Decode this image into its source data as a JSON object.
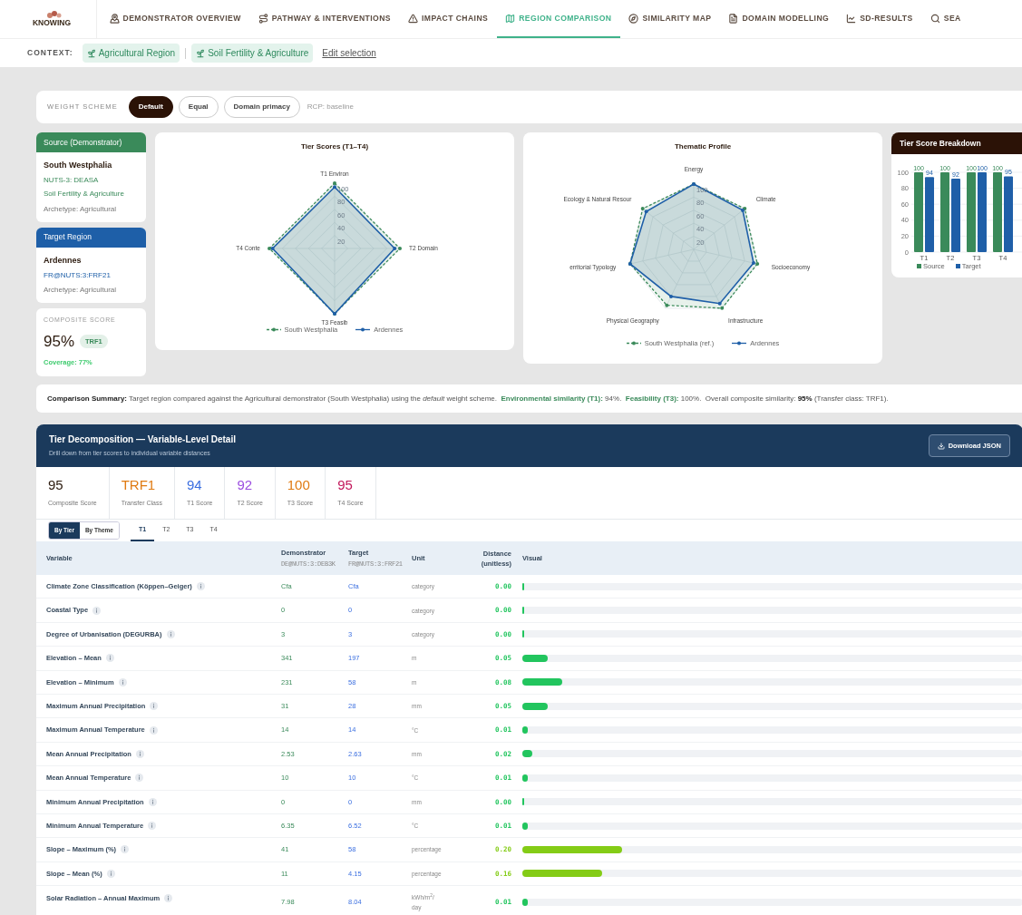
{
  "logo": "KNOWING",
  "nav": [
    {
      "label": "DEMONSTRATOR OVERVIEW",
      "selected": false
    },
    {
      "label": "PATHWAY & INTERVENTIONS",
      "selected": false
    },
    {
      "label": "IMPACT CHAINS",
      "selected": false
    },
    {
      "label": "REGION COMPARISON",
      "selected": true
    },
    {
      "label": "SIMILARITY MAP",
      "selected": false
    },
    {
      "label": "DOMAIN MODELLING",
      "selected": false
    },
    {
      "label": "SD-RESULTS",
      "selected": false
    },
    {
      "label": "SEA",
      "selected": false
    }
  ],
  "context": {
    "label": "CONTEXT:",
    "chips": [
      "Agricultural Region",
      "Soil Fertility & Agriculture"
    ],
    "link": "Edit selection"
  },
  "weight_scheme": {
    "label": "WEIGHT SCHEME",
    "options": [
      {
        "label": "Default",
        "selected": true
      },
      {
        "label": "Equal",
        "selected": false
      },
      {
        "label": "Domain primacy",
        "selected": false
      }
    ],
    "rcp": "RCP: baseline"
  },
  "source": {
    "header": "Source (Demonstrator)",
    "name": "South Westphalia",
    "code": "NUTS-3: DEASA",
    "domain": "Soil Fertility & Agriculture",
    "archetype": "Archetype: Agricultural"
  },
  "target": {
    "header": "Target Region",
    "name": "Ardennes",
    "code": "FR@NUTS:3:FRF21",
    "archetype": "Archetype: Agricultural"
  },
  "composite": {
    "label": "COMPOSITE SCORE",
    "value": "95%",
    "badge": "TRF1",
    "coverage": "Coverage: 77%"
  },
  "tier_scores": {
    "title": "Tier Scores (T1–T4)",
    "axes": [
      "T1 Environ",
      "T4 Conte",
      "T2 Domain",
      "T3 Feasib"
    ],
    "ticks": [
      "100",
      "80",
      "60",
      "40",
      "20"
    ],
    "legend": [
      {
        "name": "South Westphalia",
        "color": "#3a8a5a"
      },
      {
        "name": "Ardennes",
        "color": "#1f5fa8"
      }
    ]
  },
  "thematic_profile": {
    "title": "Thematic Profile",
    "axes": [
      "Energy",
      "Ecology & Natural Resour",
      "Climate",
      "erritorial Typology",
      "Socioeconomy",
      "Physical Geography",
      "Infrastructure"
    ],
    "ticks": [
      "100",
      "80",
      "60",
      "40",
      "20"
    ],
    "legend": [
      {
        "name": "South Westphalia (ref.)",
        "color": "#3a8a5a"
      },
      {
        "name": "Ardennes",
        "color": "#1f5fa8"
      }
    ]
  },
  "tier_breakdown": {
    "chart_data": {
      "type": "bar",
      "title": "Tier Score Breakdown",
      "categories": [
        "T1",
        "T2",
        "T3",
        "T4"
      ],
      "ylim": [
        0,
        100
      ],
      "yticks": [
        0,
        20,
        40,
        60,
        80,
        100
      ],
      "data_labels": true,
      "grid": true,
      "series": [
        {
          "name": "Source",
          "color": "#3a8a5a",
          "values": [
            100,
            100,
            100,
            100
          ]
        },
        {
          "name": "Target",
          "color": "#1f5fa8",
          "values": [
            94,
            92,
            100,
            95
          ]
        }
      ]
    }
  },
  "summary": [
    {
      "kind": "lead",
      "text": "Comparison Summary:"
    },
    {
      "kind": "plain",
      "text": " Target region compared against the Agricultural demonstrator (South Westphalia) using the "
    },
    {
      "kind": "italic",
      "text": "default"
    },
    {
      "kind": "plain",
      "text": " weight scheme.  "
    },
    {
      "kind": "accent",
      "text": "Environmental similarity (T1):"
    },
    {
      "kind": "plain",
      "text": " 94%.  "
    },
    {
      "kind": "accent",
      "text": "Feasibility (T3):"
    },
    {
      "kind": "plain",
      "text": " 100%.  Overall composite similarity: "
    },
    {
      "kind": "lead",
      "text": "95%"
    },
    {
      "kind": "plain",
      "text": " (Transfer class: TRF1)."
    }
  ],
  "decomposition": {
    "title": "Tier Decomposition — Variable-Level Detail",
    "subtitle": "Drill down from tier scores to individual variable distances",
    "download": "Download JSON",
    "stats": [
      {
        "value": "95",
        "label": "Composite Score",
        "color": "#2b1a0e"
      },
      {
        "value": "TRF1",
        "label": "Transfer Class",
        "color": "#e07b12"
      },
      {
        "value": "94",
        "label": "T1 Score",
        "color": "#3b6fe0"
      },
      {
        "value": "92",
        "label": "T2 Score",
        "color": "#9b4de0"
      },
      {
        "value": "100",
        "label": "T3 Score",
        "color": "#e07b12"
      },
      {
        "value": "95",
        "label": "T4 Score",
        "color": "#c2185b"
      }
    ],
    "views": [
      {
        "label": "By Tier",
        "selected": true
      },
      {
        "label": "By Theme",
        "selected": false
      }
    ],
    "tiers": [
      {
        "label": "T1",
        "selected": true
      },
      {
        "label": "T2",
        "selected": false
      },
      {
        "label": "T3",
        "selected": false
      },
      {
        "label": "T4",
        "selected": false
      }
    ],
    "columns": {
      "variable": "Variable",
      "demonstrator": "Demonstrator",
      "demonstrator_code": "DE@NUTS:3:DEB3K",
      "target": "Target",
      "target_code": "FR@NUTS:3:FRF21",
      "unit": "Unit",
      "distance": "Distance (unitless)",
      "visual": "Visual"
    },
    "rows": [
      {
        "variable": "Climate Zone Classification (Köppen–Geiger)",
        "demonstrator": "Cfa",
        "target": "Cfa",
        "unit": "category",
        "distance": "0.00",
        "level": 0
      },
      {
        "variable": "Coastal Type",
        "demonstrator": "0",
        "target": "0",
        "unit": "category",
        "distance": "0.00",
        "level": 0
      },
      {
        "variable": "Degree of Urbanisation (DEGURBA)",
        "demonstrator": "3",
        "target": "3",
        "unit": "category",
        "distance": "0.00",
        "level": 0
      },
      {
        "variable": "Elevation – Mean",
        "demonstrator": "341",
        "target": "197",
        "unit": "m",
        "distance": "0.05",
        "level": 0.05
      },
      {
        "variable": "Elevation – Minimum",
        "demonstrator": "231",
        "target": "58",
        "unit": "m",
        "distance": "0.08",
        "level": 0.08
      },
      {
        "variable": "Maximum Annual Precipitation",
        "demonstrator": "31",
        "target": "28",
        "unit": "mm",
        "distance": "0.05",
        "level": 0.05
      },
      {
        "variable": "Maximum Annual Temperature",
        "demonstrator": "14",
        "target": "14",
        "unit": "°C",
        "distance": "0.01",
        "level": 0.01
      },
      {
        "variable": "Mean Annual Precipitation",
        "demonstrator": "2.53",
        "target": "2.63",
        "unit": "mm",
        "distance": "0.02",
        "level": 0.02
      },
      {
        "variable": "Mean Annual Temperature",
        "demonstrator": "10",
        "target": "10",
        "unit": "°C",
        "distance": "0.01",
        "level": 0.01
      },
      {
        "variable": "Minimum Annual Precipitation",
        "demonstrator": "0",
        "target": "0",
        "unit": "mm",
        "distance": "0.00",
        "level": 0
      },
      {
        "variable": "Minimum Annual Temperature",
        "demonstrator": "6.35",
        "target": "6.52",
        "unit": "°C",
        "distance": "0.01",
        "level": 0.01
      },
      {
        "variable": "Slope – Maximum (%)",
        "demonstrator": "41",
        "target": "58",
        "unit": "percentage",
        "distance": "0.20",
        "level": 0.2
      },
      {
        "variable": "Slope – Mean (%)",
        "demonstrator": "11",
        "target": "4.15",
        "unit": "percentage",
        "distance": "0.16",
        "level": 0.16
      },
      {
        "variable": "Solar Radiation – Annual Maximum",
        "demonstrator": "7.98",
        "target": "8.04",
        "unit": "kWh/m$^{2}$/ day",
        "distance": "0.01",
        "level": 0.01
      }
    ]
  }
}
